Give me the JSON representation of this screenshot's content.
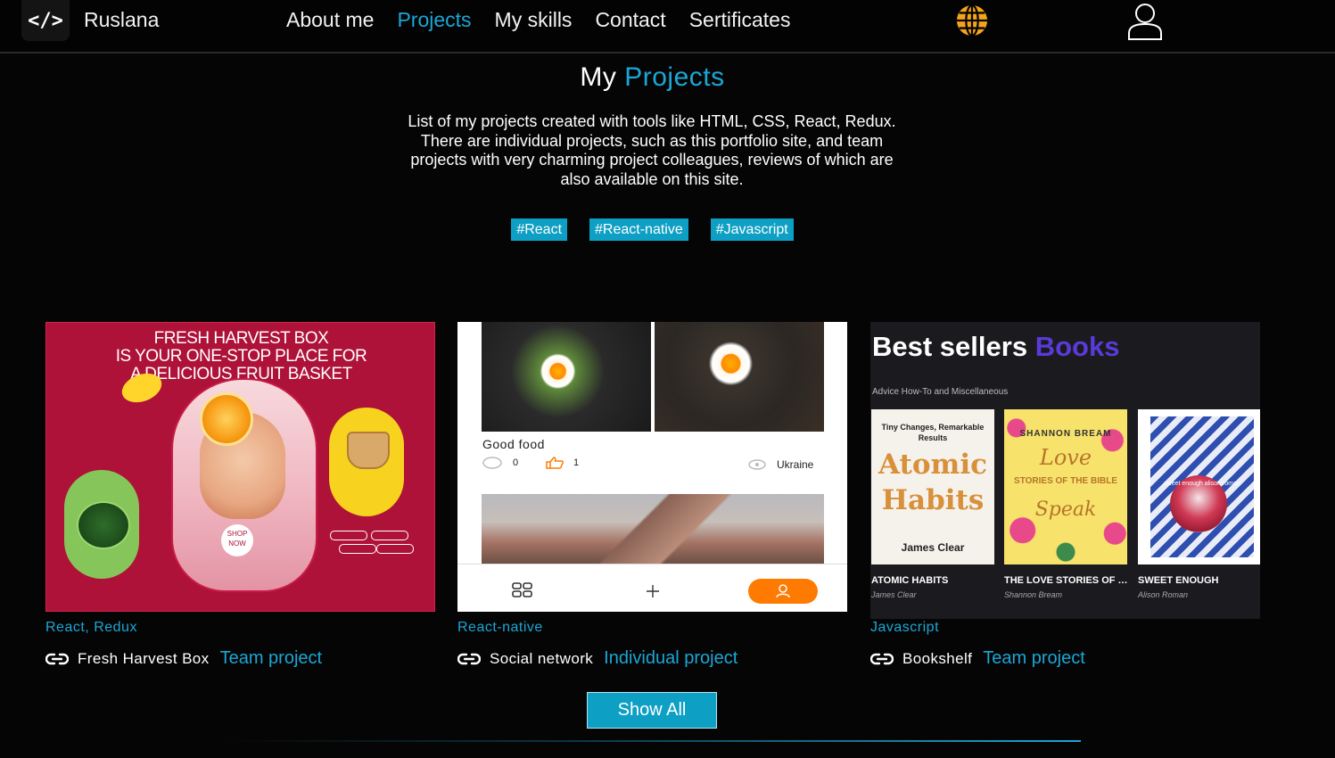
{
  "header": {
    "logo": "</>",
    "brand": "Ruslana",
    "nav": [
      {
        "label": "About me",
        "active": false
      },
      {
        "label": "Projects",
        "active": true
      },
      {
        "label": "My skills",
        "active": false
      },
      {
        "label": "Contact",
        "active": false
      },
      {
        "label": "Sertificates",
        "active": false
      }
    ],
    "icons": {
      "language": "globe-icon",
      "account": "user-icon"
    },
    "colors": {
      "accent": "#1ba7d6",
      "globe": "#f5a31a"
    }
  },
  "section": {
    "title_plain": "My",
    "title_accent": "Projects",
    "intro": "List of my projects created with tools like HTML, CSS, React, Redux. There are individual projects, such as this portfolio site, and team projects with very charming project colleagues, reviews of which are also available on this site.",
    "tags": [
      "#React",
      "#React-native",
      "#Javascript"
    ]
  },
  "projects": [
    {
      "tech": "React, Redux",
      "name": "Fresh Harvest Box",
      "kind": "Team project",
      "preview": {
        "headline": "FRESH HARVEST BOX\nIS YOUR ONE-STOP PLACE FOR\nA DELICIOUS FRUIT BASKET",
        "shop": "SHOP NOW"
      }
    },
    {
      "tech": "React-native",
      "name": "Social network",
      "kind": "Individual project",
      "preview": {
        "caption": "Good food",
        "comments": "0",
        "likes": "1",
        "location": "Ukraine"
      }
    },
    {
      "tech": "Javascript",
      "name": "Bookshelf",
      "kind": "Team project",
      "preview": {
        "title_plain": "Best sellers",
        "title_accent": "Books",
        "category": "Advice How-To and Miscellaneous",
        "books": [
          {
            "cover_top": "Tiny Changes, Remarkable Results",
            "cover_main": "Atomic Habits",
            "cover_author": "James Clear",
            "title": "ATOMIC HABITS",
            "author": "James Clear"
          },
          {
            "cover_top": "SHANNON BREAM",
            "cover_main": "Love",
            "cover_mid": "STORIES OF THE BIBLE",
            "cover_end": "Speak",
            "title": "THE LOVE STORIES OF THE BIBLE SPEAK",
            "author": "Shannon Bream"
          },
          {
            "cover_main": "sweet enough alison roman",
            "title": "SWEET ENOUGH",
            "author": "Alison Roman"
          }
        ]
      }
    }
  ],
  "show_all": "Show All"
}
